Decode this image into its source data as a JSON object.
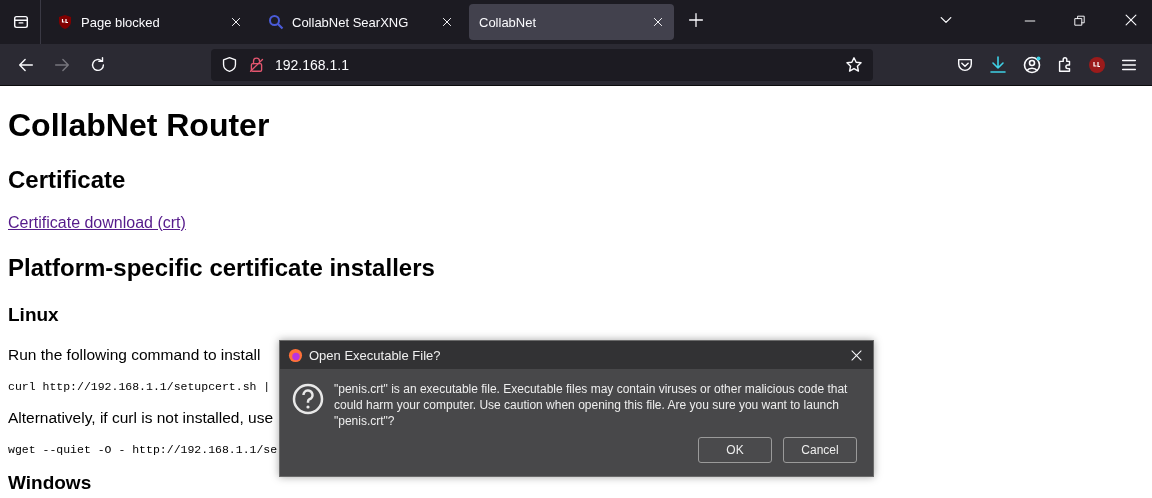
{
  "tabs": [
    {
      "label": "Page blocked",
      "selected": false
    },
    {
      "label": "CollabNet SearXNG",
      "selected": false
    },
    {
      "label": "CollabNet",
      "selected": true
    }
  ],
  "address_bar": {
    "url": "192.168.1.1"
  },
  "page": {
    "title": "CollabNet Router",
    "blocks": [
      {
        "kind": "h2",
        "text": "Certificate"
      },
      {
        "kind": "link",
        "text": "Certificate download (crt)"
      },
      {
        "kind": "h2",
        "text": "Platform-specific certificate installers"
      },
      {
        "kind": "h3",
        "text": "Linux"
      },
      {
        "kind": "p",
        "text": "Run the following command to install"
      },
      {
        "kind": "code",
        "text": "curl http://192.168.1.1/setupcert.sh |"
      },
      {
        "kind": "p",
        "text": "Alternatively, if curl is not installed, use"
      },
      {
        "kind": "code",
        "text": "wget --quiet -O - http://192.168.1.1/se"
      },
      {
        "kind": "h3",
        "text": "Windows"
      }
    ]
  },
  "dialog": {
    "title": "Open Executable File?",
    "message": "\"penis.crt\" is an executable file. Executable files may contain viruses or other malicious code that could harm your computer. Use caution when opening this file. Are you sure you want to launch \"penis.crt\"?",
    "buttons": [
      "OK",
      "Cancel"
    ]
  }
}
